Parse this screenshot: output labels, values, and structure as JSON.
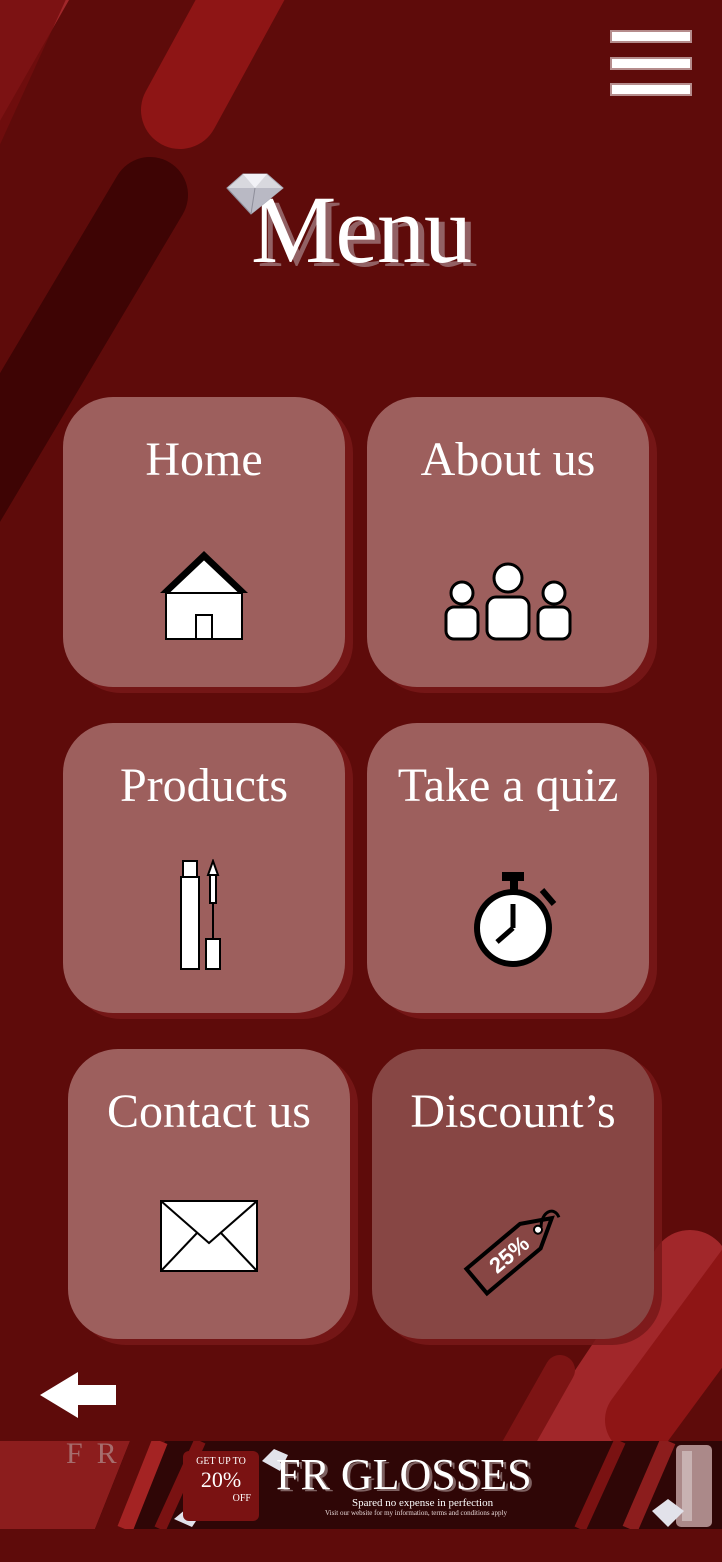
{
  "page": {
    "title": "Menu"
  },
  "nav": {
    "menu_icon": "hamburger-icon",
    "back_icon": "back-arrow-icon"
  },
  "tiles": [
    {
      "label": "Home",
      "icon": "house-icon"
    },
    {
      "label": "About us",
      "icon": "people-icon"
    },
    {
      "label": "Products",
      "icon": "lipgloss-icon"
    },
    {
      "label": "Take a quiz",
      "icon": "stopwatch-icon"
    },
    {
      "label": "Contact us",
      "icon": "envelope-icon"
    },
    {
      "label": "Discount’s",
      "icon": "price-tag-icon",
      "tag_text": "25%"
    }
  ],
  "banner": {
    "fr_text": "FR",
    "badge_top": "GET UP TO",
    "badge_value": "20%",
    "badge_bottom": "OFF",
    "brand": "FR GLOSSES",
    "tagline": "Spared no expense in perfection",
    "fine_print": "Visit our website for my information, terms and conditions apply"
  },
  "colors": {
    "background": "#5e0b0a",
    "tile": "#9d5f5d",
    "tile_selected": "#874644",
    "stripe": "#9a2020",
    "text": "#ffffff"
  }
}
